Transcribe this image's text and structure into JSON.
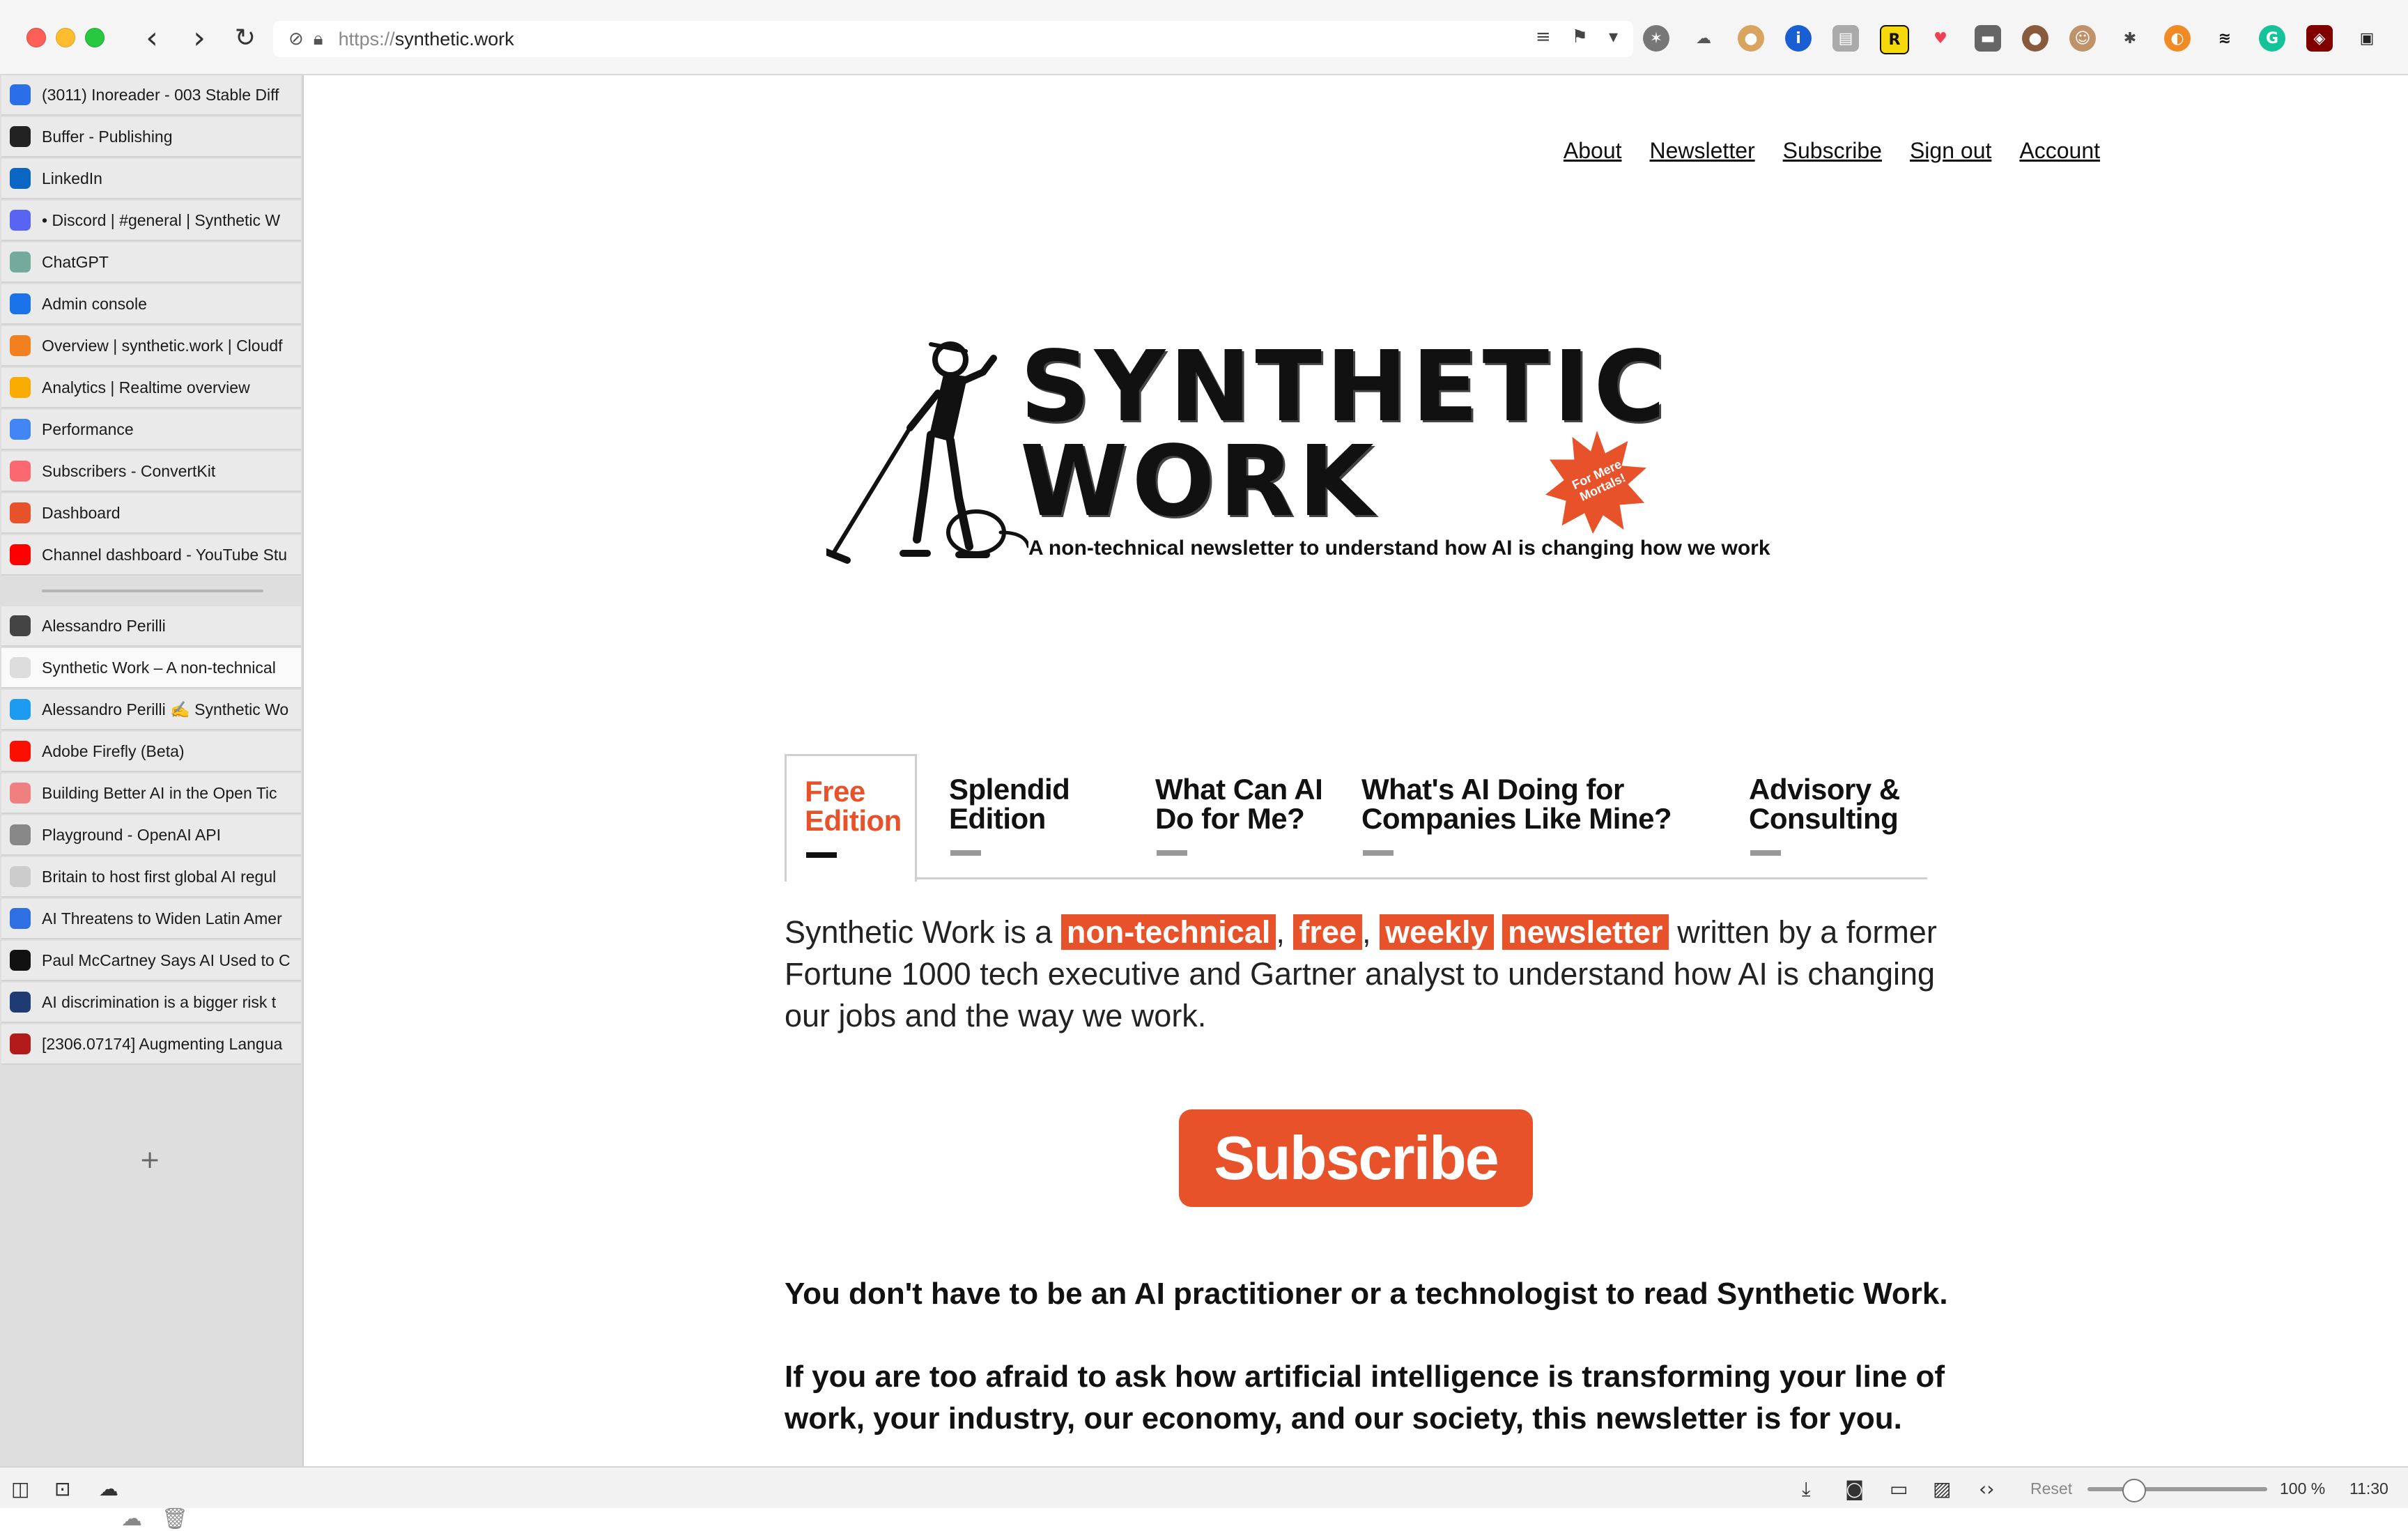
{
  "browser": {
    "url_protocol": "https://",
    "url_host": "synthetic.work",
    "extension_letter": "R"
  },
  "sidebar": {
    "pinned_tabs": [
      {
        "label": "(3011) Inoreader - 003 Stable Diff",
        "icon": "inoreader-icon",
        "color": "#2a6ee8"
      },
      {
        "label": "Buffer - Publishing",
        "icon": "buffer-icon",
        "color": "#222222"
      },
      {
        "label": "LinkedIn",
        "icon": "linkedin-icon",
        "color": "#0a66c2"
      },
      {
        "label": "• Discord | #general | Synthetic W",
        "icon": "discord-icon",
        "color": "#5865f2"
      },
      {
        "label": "ChatGPT",
        "icon": "chatgpt-icon",
        "color": "#74aa9c"
      },
      {
        "label": "Admin console",
        "icon": "admin-console-icon",
        "color": "#1a73e8"
      },
      {
        "label": "Overview | synthetic.work | Cloudf",
        "icon": "cloudflare-icon",
        "color": "#f38020"
      },
      {
        "label": "Analytics | Realtime overview",
        "icon": "analytics-icon",
        "color": "#f9ab00"
      },
      {
        "label": "Performance",
        "icon": "performance-icon",
        "color": "#4285f4"
      },
      {
        "label": "Subscribers - ConvertKit",
        "icon": "convertkit-icon",
        "color": "#fb6970"
      },
      {
        "label": "Dashboard",
        "icon": "dashboard-icon",
        "color": "#e8522a"
      },
      {
        "label": "Channel dashboard - YouTube Stu",
        "icon": "youtube-icon",
        "color": "#ff0000"
      }
    ],
    "tabs": [
      {
        "label": "Alessandro Perilli",
        "icon": "avatar-icon",
        "color": "#444444"
      },
      {
        "label": "Synthetic Work – A non-technical",
        "icon": "synthetic-work-icon",
        "color": "#dddddd"
      },
      {
        "label": "Alessandro Perilli ✍️ Synthetic Wo",
        "icon": "twitter-icon",
        "color": "#1d9bf0"
      },
      {
        "label": "Adobe Firefly (Beta)",
        "icon": "adobe-icon",
        "color": "#fa0f00"
      },
      {
        "label": "Building Better AI in the Open Tic",
        "icon": "tab-icon-e",
        "color": "#f08080"
      },
      {
        "label": "Playground - OpenAI API",
        "icon": "openai-icon",
        "color": "#888888"
      },
      {
        "label": "Britain to host first global AI regul",
        "icon": "page-icon",
        "color": "#cccccc"
      },
      {
        "label": "AI Threatens to Widen Latin Amer",
        "icon": "bloomberg-icon",
        "color": "#2f6fe4"
      },
      {
        "label": "Paul McCartney Says AI Used to C",
        "icon": "wsj-icon",
        "color": "#111111"
      },
      {
        "label": "AI discrimination is a bigger risk t",
        "icon": "tab-icon-c",
        "color": "#1f3b73"
      },
      {
        "label": "[2306.07174] Augmenting Langua",
        "icon": "arxiv-icon",
        "color": "#b31b1b"
      }
    ]
  },
  "statusbar": {
    "reset_label": "Reset",
    "zoom_label": "100 %",
    "clock": "11:30",
    "zoom_percent": 100
  },
  "page": {
    "nav": [
      "About",
      "Newsletter",
      "Subscribe",
      "Sign out",
      "Account"
    ],
    "logo_line1": "SYNTHETIC",
    "logo_line2": "WORK",
    "logo_badge": "For Mere Mortals!",
    "tagline": "A non-technical newsletter to understand how AI is changing how we work",
    "tabs": [
      {
        "line1": "Free",
        "line2": "Edition"
      },
      {
        "line1": "Splendid",
        "line2": "Edition"
      },
      {
        "line1": "What Can AI",
        "line2": "Do for Me?"
      },
      {
        "line1": "What's AI Doing for",
        "line2": "Companies Like Mine?"
      },
      {
        "line1": "Advisory &",
        "line2": "Consulting"
      }
    ],
    "intro_lead": "Synthetic Work is a",
    "intro_hl1": "non-technical",
    "intro_hl2": "free",
    "intro_hl3": "weekly",
    "intro_hl4": "newsletter",
    "intro_rest": "written by a former Fortune 1000 tech executive and Gartner analyst to understand how AI is changing our jobs and the way we work.",
    "subscribe_label": "Subscribe",
    "para1": "You don't have to be an AI practitioner or a technologist to read Synthetic Work.",
    "para2": "If you are too afraid to ask how artificial intelligence is transforming your line of work, your industry, our economy, and our society, this newsletter is for you."
  },
  "colors": {
    "accent": "#e8522a"
  }
}
